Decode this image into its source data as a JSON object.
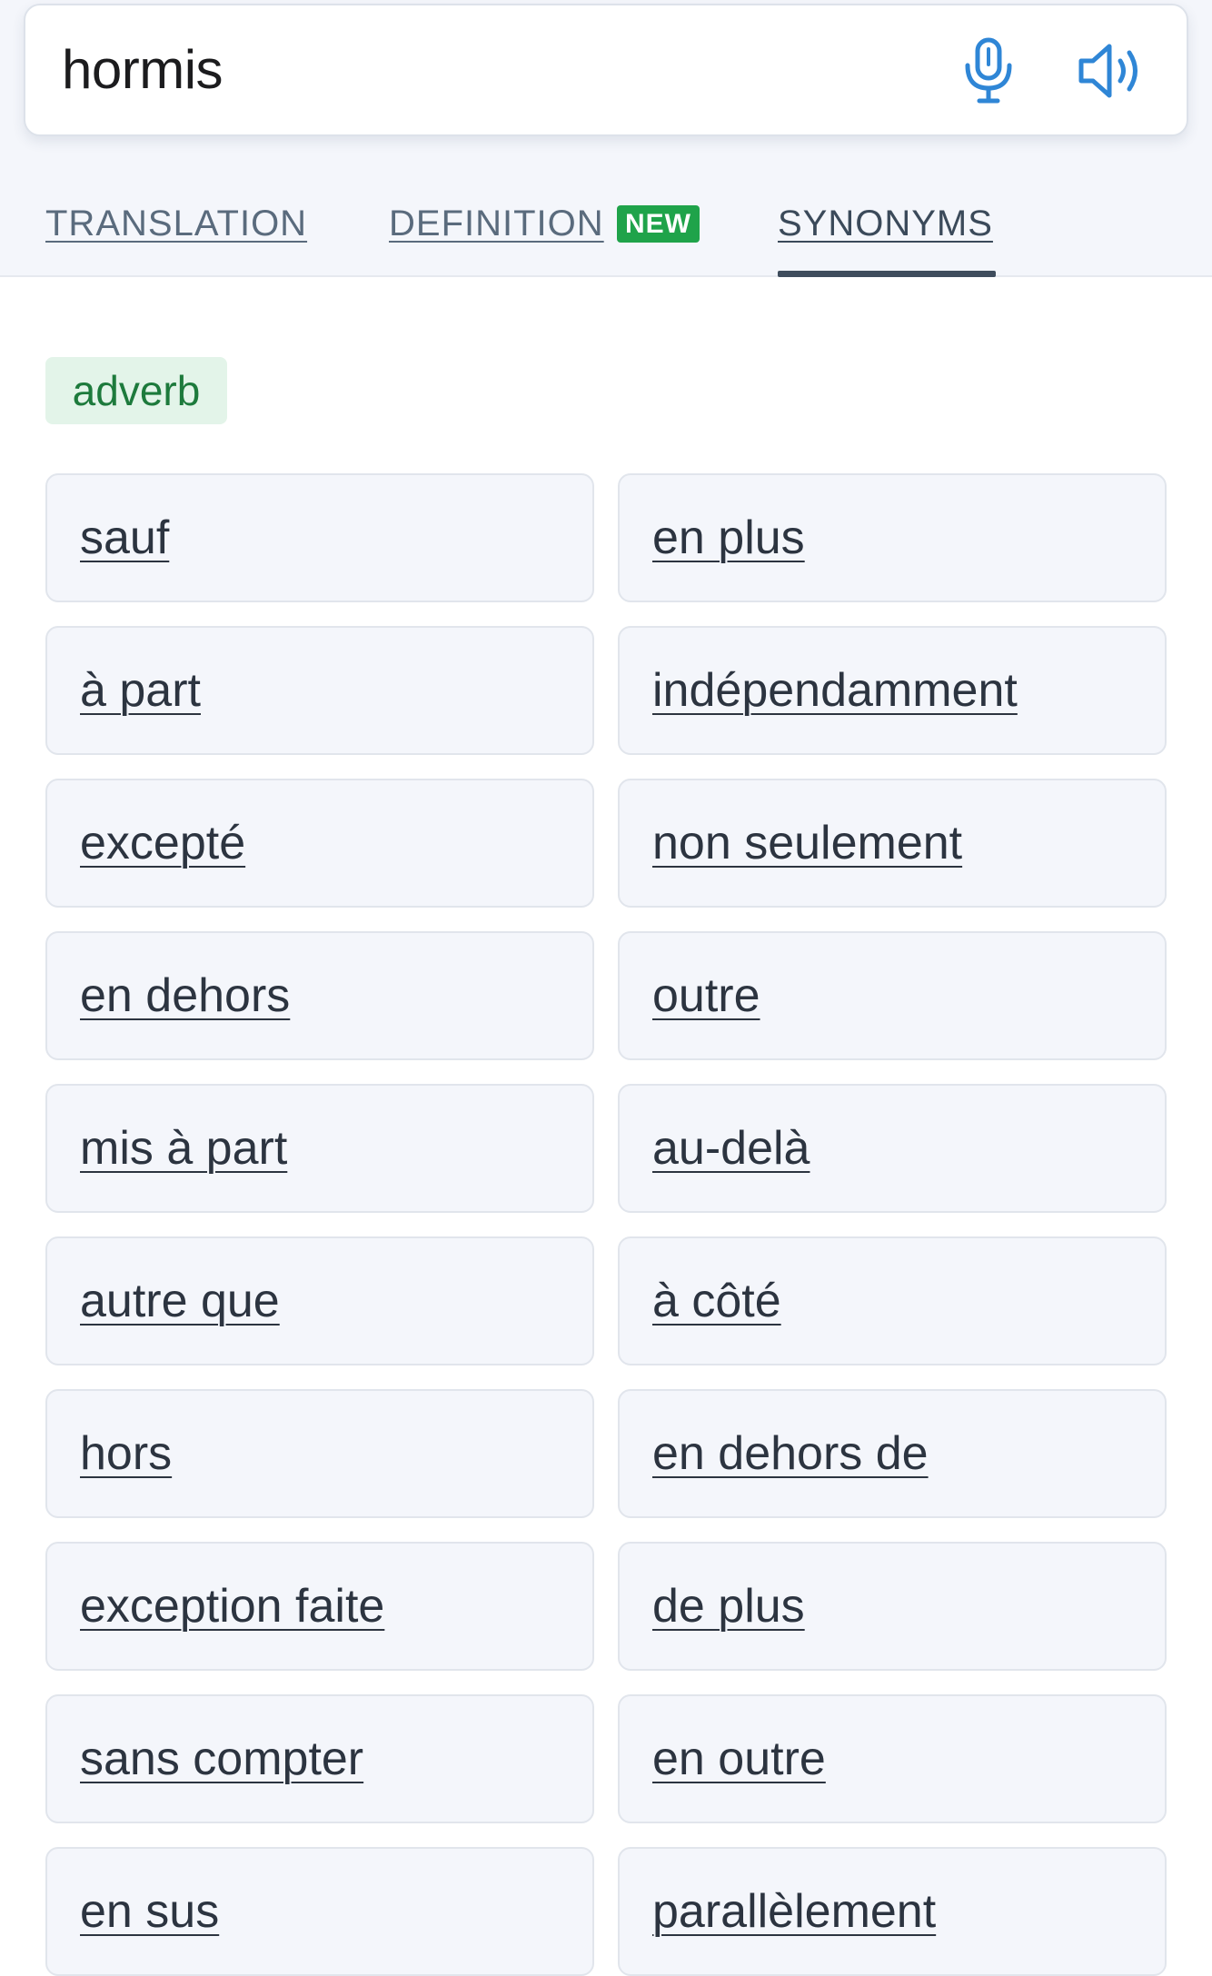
{
  "search": {
    "query": "hormis"
  },
  "icons": {
    "mic": "microphone-icon",
    "speaker": "speaker-icon"
  },
  "tabs": [
    {
      "label": "TRANSLATION",
      "active": false
    },
    {
      "label": "DEFINITION",
      "badge": "NEW",
      "active": false
    },
    {
      "label": "SYNONYMS",
      "active": true
    }
  ],
  "section": {
    "part_of_speech": "adverb"
  },
  "synonyms": [
    "sauf",
    "en plus",
    "à part",
    "indépendamment",
    "excepté",
    "non seulement",
    "en dehors",
    "outre",
    "mis à part",
    "au-delà",
    "autre que",
    "à côté",
    "hors",
    "en dehors de",
    "exception faite",
    "de plus",
    "sans compter",
    "en outre",
    "en sus",
    "parallèlement"
  ],
  "colors": {
    "accent_blue": "#2f86d6",
    "new_badge": "#1fa34a",
    "pos_badge_bg": "#e3f4e9",
    "pos_badge_text": "#1d7a3c"
  }
}
